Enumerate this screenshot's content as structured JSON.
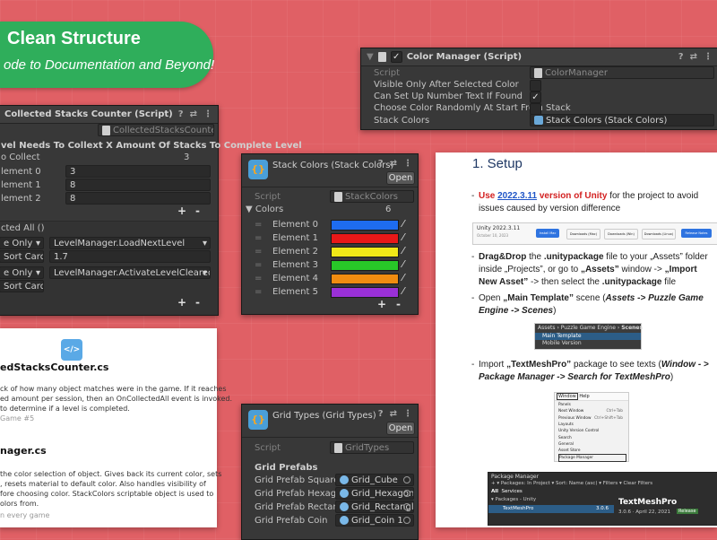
{
  "banner": {
    "title": "Clean Structure",
    "subtitle": "ode to Documentation and Beyond!"
  },
  "color_manager": {
    "title": "Color Manager (Script)",
    "script_label": "Script",
    "script_value": "ColorManager",
    "rows": [
      {
        "label": "Visible Only After Selected Color",
        "checked": ""
      },
      {
        "label": "Can Set Up Number Text If Found",
        "checked": "✓"
      },
      {
        "label": "Choose Color Randomly At Start From Stack",
        "checked": ""
      }
    ],
    "stack_label": "Stack Colors",
    "stack_value": "Stack Colors (Stack Colors)"
  },
  "stacks_counter": {
    "title": "Collected Stacks Counter (Script)",
    "script_value": "CollectedStacksCounter",
    "header_label": "vel Needs To Collext X Amount Of Stacks To Complete Level",
    "collect_label": "o Collect",
    "collect_value": "3",
    "elements": [
      {
        "label": "lement 0",
        "value": "3"
      },
      {
        "label": "lement 1",
        "value": "8"
      },
      {
        "label": "lement 2",
        "value": "8"
      }
    ],
    "event_label": "cted All ()",
    "events": [
      {
        "mode": "e Only",
        "func": "LevelManager.LoadNextLevel",
        "obj": "Sort Cards",
        "arg": "1.7"
      },
      {
        "mode": "e Only",
        "func": "LevelManager.ActivateLevelClearedPanel",
        "obj": "Sort Cards"
      }
    ],
    "plus": "+",
    "minus": "-"
  },
  "stack_colors": {
    "title": "Stack Colors (Stack Colors)",
    "open": "Open",
    "script_label": "Script",
    "script_value": "StackColors",
    "colors_label": "Colors",
    "colors_count": "6",
    "elements": [
      {
        "label": "Element 0",
        "color": "#1e6cf0"
      },
      {
        "label": "Element 1",
        "color": "#e81818"
      },
      {
        "label": "Element 2",
        "color": "#f0e818"
      },
      {
        "label": "Element 3",
        "color": "#28c828"
      },
      {
        "label": "Element 4",
        "color": "#f08c10"
      },
      {
        "label": "Element 5",
        "color": "#9a30d8"
      }
    ],
    "plus": "+",
    "minus": "-"
  },
  "grid_types": {
    "title": "Grid Types (Grid Types)",
    "open": "Open",
    "script_label": "Script",
    "script_value": "GridTypes",
    "section": "Grid Prefabs",
    "rows": [
      {
        "label": "Grid Prefab Square",
        "value": "Grid_Cube"
      },
      {
        "label": "Grid Prefab Hexagon",
        "value": "Grid_Hexagon"
      },
      {
        "label": "Grid Prefab Rectangle",
        "value": "Grid_Rectangle"
      },
      {
        "label": "Grid Prefab Coin",
        "value": "Grid_Coin 1"
      }
    ]
  },
  "doc_left": {
    "icon_text": "</>",
    "file1": "edStacksCounter.cs",
    "desc1": [
      "ck of how many object matches were in the game. If it reaches",
      "ed amount per session, then an OnCollectedAll event is invoked.",
      "to determine if a level is completed."
    ],
    "used1": "Game #5",
    "file2": "nager.cs",
    "desc2": [
      "the color selection of object. Gives back its current color, sets",
      ", resets material to default color. Also handles visibility of",
      "fore choosing color. StackColors scriptable object is used to",
      "olors from."
    ],
    "used2": "n every game"
  },
  "setup": {
    "heading": "1. Setup",
    "b1_pre": "Use ",
    "b1_link": "2022.3.11",
    "b1_red": " version of Unity",
    "b1_rest": " for the project to avoid issues caused by version difference",
    "b2_a": "Drag&Drop",
    "b2_b": " the ",
    ".b2_c": "",
    "b2_text": ".unitypackage",
    "b2_rest": " file to your „Assets” folder inside „Projects”, or go to ",
    "b2_assets": "„Assets”",
    "b2_mid": " window -> ",
    "b2_import": "„Import New Asset”",
    "b2_then": " -> then select the ",
    "b2_pkg": ".unitypackage",
    "b2_end": " file",
    "b3_pre": "Open ",
    "b3_scene": "„Main Template”",
    "b3_mid": " scene (",
    "b3_path": "Assets -> Puzzle Game Engine -> Scenes",
    "b3_end": ")",
    "b4_pre": "Import ",
    "b4_tmp": "„TextMeshPro”",
    "b4_mid": " package to see texts (",
    "b4_path": "Window - > Package Manager -> Search for TextMeshPro",
    "b4_end": ")",
    "hub_version": "Unity 2022.3.11",
    "hub_date": "October 10, 2023",
    "hub_buttons": [
      "Install Mac",
      "Downloads (Mac)",
      "Downloads (Win)",
      "Downloads (Linux)",
      "Release Notes"
    ],
    "scene_path": [
      "Assets",
      "Puzzle Game Engine",
      "Scenes"
    ],
    "scene_items": [
      "Main Template",
      "Mobile Version"
    ],
    "menu_bar": [
      "Window",
      "Help"
    ],
    "menu_items": [
      {
        "label": "Panels",
        "key": ""
      },
      {
        "label": "Next Window",
        "key": "Ctrl+Tab"
      },
      {
        "label": "Previous Window",
        "key": "Ctrl+Shift+Tab"
      },
      {
        "label": "Layouts",
        "key": ""
      },
      {
        "label": "Unity Version Control",
        "key": ""
      },
      {
        "label": "Search",
        "key": ""
      },
      {
        "label": "General",
        "key": ""
      },
      {
        "label": "Asset Store",
        "key": ""
      },
      {
        "label": "Package Manager",
        "key": ""
      }
    ],
    "pm": {
      "title": "Package Manager",
      "toolbar": "+ ▾  Packages: In Project ▾  Sort: Name (asc) ▾  Filters ▾  Clear Filters",
      "tabs": [
        "All",
        "Services"
      ],
      "group": "Packages - Unity",
      "item": "TextMeshPro",
      "item_ver": "3.0.6",
      "detail_title": "TextMeshPro",
      "detail_ver": "3.0.6 · April 22, 2021",
      "badge": "Release"
    }
  }
}
